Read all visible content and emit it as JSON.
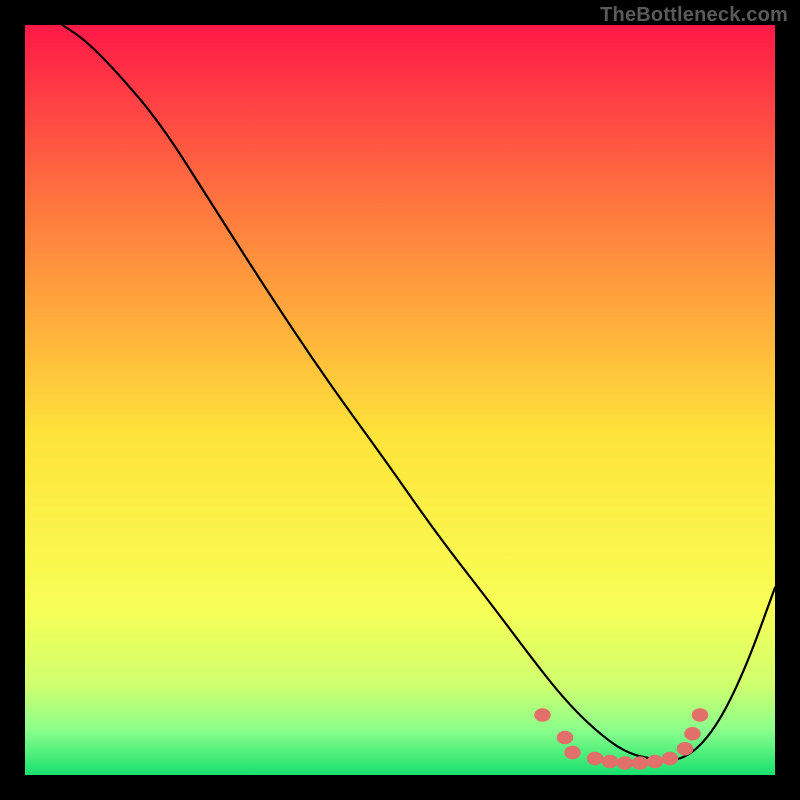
{
  "watermark": "TheBottleneck.com",
  "chart_data": {
    "type": "line",
    "title": "",
    "xlabel": "",
    "ylabel": "",
    "xlim": [
      0,
      100
    ],
    "ylim": [
      0,
      100
    ],
    "series": [
      {
        "name": "curve",
        "x": [
          5,
          8,
          12,
          18,
          25,
          32,
          40,
          48,
          55,
          62,
          68,
          72,
          76,
          80,
          84,
          88,
          92,
          96,
          100
        ],
        "y": [
          100,
          98,
          94,
          87,
          76,
          65,
          53,
          42,
          32,
          23,
          15,
          10,
          6,
          3,
          2,
          2,
          6,
          14,
          25
        ]
      }
    ],
    "scatter_points": {
      "name": "highlight-cluster",
      "color": "#e26f6a",
      "x": [
        69,
        72,
        73,
        76,
        78,
        80,
        82,
        84,
        86,
        88,
        89,
        90
      ],
      "y": [
        8,
        5,
        3,
        2.2,
        1.8,
        1.6,
        1.6,
        1.8,
        2.2,
        3.5,
        5.5,
        8
      ]
    },
    "background_gradient": {
      "type": "vertical",
      "stops": [
        {
          "offset": 0.0,
          "color": "#ff1948"
        },
        {
          "offset": 0.25,
          "color": "#ff7a3e"
        },
        {
          "offset": 0.55,
          "color": "#ffe43a"
        },
        {
          "offset": 0.78,
          "color": "#f7ff57"
        },
        {
          "offset": 0.88,
          "color": "#d0ff6e"
        },
        {
          "offset": 0.94,
          "color": "#8bff8b"
        },
        {
          "offset": 1.0,
          "color": "#18e06e"
        }
      ]
    }
  }
}
